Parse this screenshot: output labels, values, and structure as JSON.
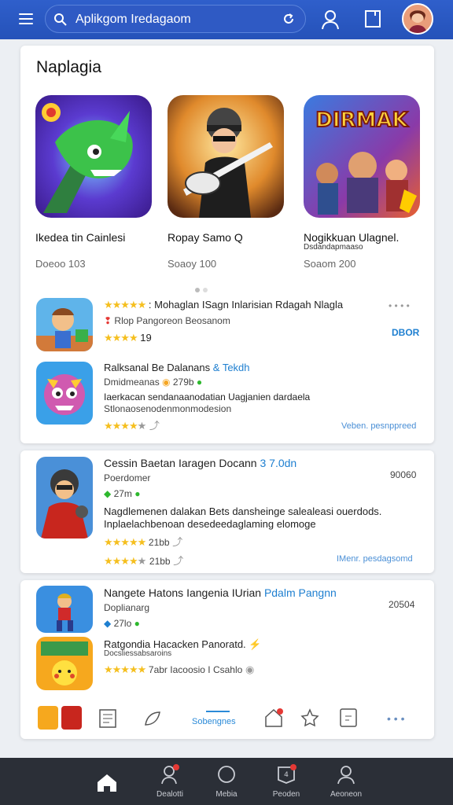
{
  "header": {
    "search_text": "Aplikgom Iredagaom",
    "icons": [
      "menu-icon",
      "search-icon",
      "refresh-icon",
      "user-icon",
      "bookmark-icon",
      "avatar"
    ]
  },
  "section1": {
    "title": "Naplagia",
    "featured": [
      {
        "name": "Ikedea tin Cainlesi",
        "sub": "",
        "meta": "Doeoo 103",
        "icon": "green-dragon-game-icon"
      },
      {
        "name": "Ropay Samo Q",
        "sub": "",
        "meta": "Soaoy 100",
        "icon": "guitar-hero-game-icon"
      },
      {
        "name": "Nogikkuan Ulagnel.",
        "sub": "Dsdandapmaaso",
        "meta": "Soaom 200",
        "icon": "dirmak-action-game-icon",
        "banner": "DIRMAK"
      }
    ],
    "list": [
      {
        "title": "Mohaglan ISagn Inlarisian Rdagah Nlagla",
        "sub": "Rlop Pangoreon Beosanom",
        "rating": "19",
        "action": "DBOR",
        "icon": "hammer-hero-game-icon"
      },
      {
        "title": "Ralksanal Be Dalanans",
        "title_badge": "& Tekdh",
        "meta": "Dmidmeanas",
        "meta2": "279b",
        "desc1": "Iaerkacan sendanaanodatian Uagjanien dardaela",
        "desc2": "Stlonaosenodenmonmodesion",
        "link": "Veben. pesnppreed",
        "icon": "monster-game-icon"
      }
    ]
  },
  "section2": {
    "title": "Cessin Baetan Iaragen",
    "title_suffix": "Docann",
    "title_badge": "3 7.0dn",
    "meta": "Poerdomer",
    "size": "27m",
    "right": "90060",
    "desc1": "Nagdlemenen dalakan Bets dansheinge salealeasi ouerdods.",
    "desc2": "Inplaelachbenoan desedeedaglaming elomoge",
    "rating1": "21bb",
    "rating2": "21bb",
    "link": "IMenr. pesdagsomd",
    "icon": "red-ninja-game-icon"
  },
  "section3": {
    "title": "Nangete Hatons Iangenia",
    "title_mid": "IUrian",
    "title_badge": "Pdalm Pangnn",
    "meta": "Doplianarg",
    "size": "27lo",
    "right": "20504",
    "icon": "runner-game-icon",
    "item2": {
      "title": "Ratgondia Hacacken Panoratd.",
      "sub": "Docsliessabsaroins",
      "rating_text": "7abr Iacoosio I Csahlo",
      "icon": "pikachu-game-icon"
    },
    "toolbar": {
      "active_label": "Sobengnes",
      "icons": [
        "app-thumbnails",
        "news-icon",
        "leaf-icon",
        "sobengnes-tab",
        "home-alert-icon",
        "star-icon",
        "note-icon",
        "more-icon"
      ]
    }
  },
  "nav": [
    {
      "label": "",
      "icon": "home-icon",
      "active": true
    },
    {
      "label": "Dealotti",
      "icon": "person-alert-icon"
    },
    {
      "label": "Mebia",
      "icon": "circle-icon"
    },
    {
      "label": "Peoden",
      "icon": "badge-icon",
      "badge": "4"
    },
    {
      "label": "Aeoneon",
      "icon": "account-icon"
    }
  ]
}
